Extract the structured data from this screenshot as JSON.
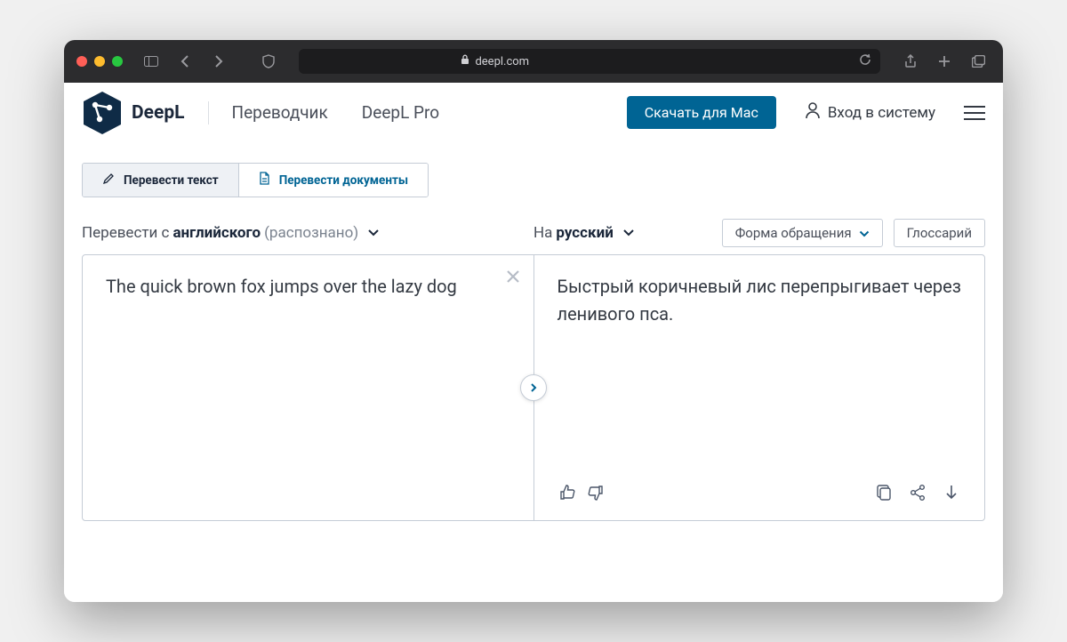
{
  "browser": {
    "url_host": "deepl.com"
  },
  "header": {
    "brand": "DeepL",
    "nav": {
      "translator": "Переводчик",
      "pro": "DeepL Pro"
    },
    "download_button": "Скачать для Mac",
    "login": "Вход в систему"
  },
  "tabs": {
    "translate_text": "Перевести текст",
    "translate_docs": "Перевести документы"
  },
  "source": {
    "prefix": "Перевести с ",
    "language": "английского",
    "detected_suffix": " (распознано)",
    "text": "The quick brown fox jumps over the lazy dog"
  },
  "target": {
    "prefix": "На ",
    "language": "русский",
    "text": "Быстрый коричневый лис перепрыгивает через ленивого пса."
  },
  "controls": {
    "formality": "Форма обращения",
    "glossary": "Глоссарий"
  }
}
